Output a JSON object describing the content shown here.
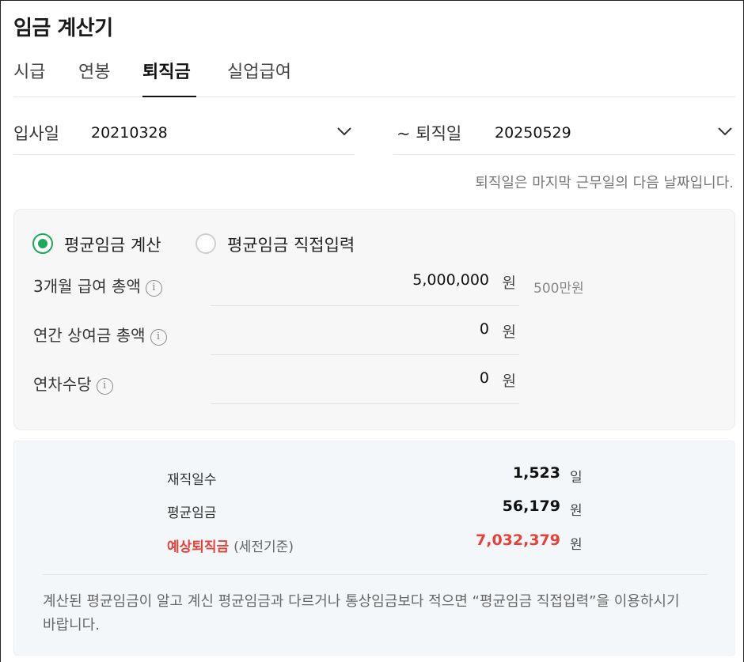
{
  "app_title": "임금 계산기",
  "tabs": [
    {
      "label": "시급",
      "active": false
    },
    {
      "label": "연봉",
      "active": false
    },
    {
      "label": "퇴직금",
      "active": true
    },
    {
      "label": "실업급여",
      "active": false
    }
  ],
  "dates": {
    "start_label": "입사일",
    "start_value": "20210328",
    "end_label": "~ 퇴직일",
    "end_value": "20250529",
    "hint": "퇴직일은 마지막 근무일의 다음 날짜입니다."
  },
  "mode": {
    "options": [
      {
        "label": "평균임금 계산",
        "selected": true
      },
      {
        "label": "평균임금 직접입력",
        "selected": false
      }
    ]
  },
  "inputs": [
    {
      "label": "3개월 급여 총액",
      "value": "5,000,000",
      "unit": "원",
      "hint": "500만원"
    },
    {
      "label": "연간 상여금 총액",
      "value": "0",
      "unit": "원",
      "hint": ""
    },
    {
      "label": "연차수당",
      "value": "0",
      "unit": "원",
      "hint": ""
    }
  ],
  "info_glyph": "i",
  "results": {
    "rows": [
      {
        "label": "재직일수",
        "sub": "",
        "value": "1,523",
        "unit": "일",
        "highlight": false
      },
      {
        "label": "평균임금",
        "sub": "",
        "value": "56,179",
        "unit": "원",
        "highlight": false
      },
      {
        "label": "예상퇴직금",
        "sub": "(세전기준)",
        "value": "7,032,379",
        "unit": "원",
        "highlight": true
      }
    ],
    "notice": "계산된 평균임금이 알고 계신 평균임금과 다르거나 통상임금보다 적으면 “평균임금 직접입력”을 이용하시기 바랍니다."
  },
  "colors": {
    "accent": "#1ea85a",
    "highlight": "#e8413a"
  }
}
